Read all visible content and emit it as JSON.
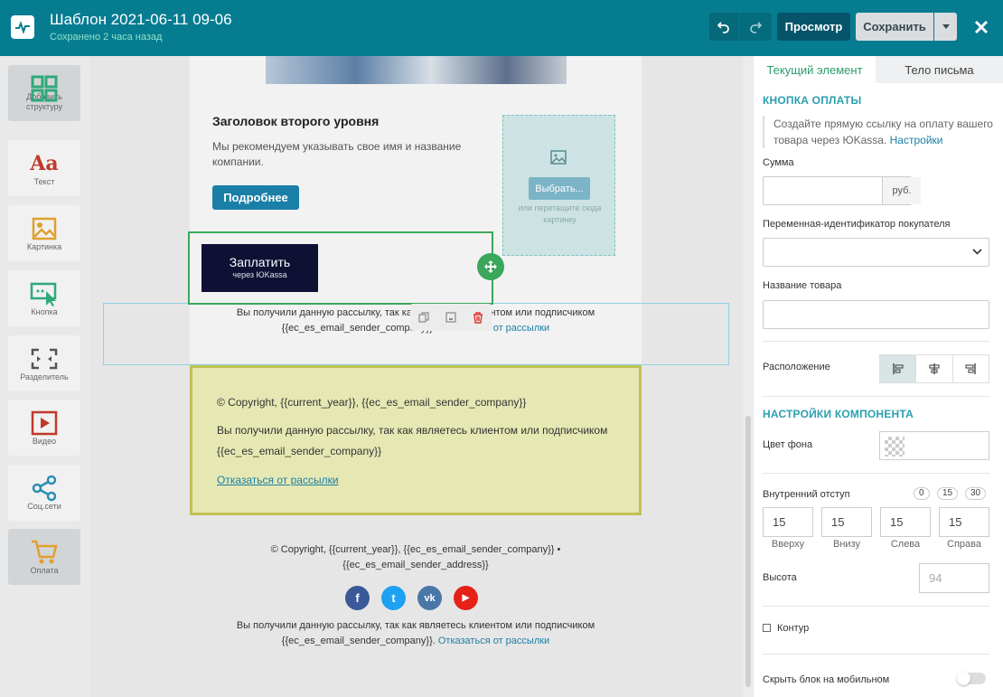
{
  "header": {
    "title": "Шаблон 2021-06-11 09-06",
    "subtitle": "Сохранено 2 часа назад",
    "preview_label": "Просмотр",
    "save_label": "Сохранить"
  },
  "palette": [
    {
      "label": "Добавить структуру",
      "icon": "grid-icon",
      "color": "#2fa87a"
    },
    {
      "label": "Текст",
      "icon": "text-aa-icon",
      "color": "#c0392b"
    },
    {
      "label": "Картинка",
      "icon": "image-icon",
      "color": "#e0a030"
    },
    {
      "label": "Кнопка",
      "icon": "button-cursor-icon",
      "color": "#2fa87a"
    },
    {
      "label": "Разделитель",
      "icon": "divider-icon",
      "color": "#555"
    },
    {
      "label": "Видео",
      "icon": "video-play-icon",
      "color": "#c0392b"
    },
    {
      "label": "Соц.сети",
      "icon": "share-icon",
      "color": "#2b8fb5"
    },
    {
      "label": "Оплата",
      "icon": "cart-icon",
      "color": "#e0a030"
    }
  ],
  "canvas": {
    "heading": "Заголовок второго уровня",
    "paragraph": "Мы рекомендуем указывать свое имя и название компании.",
    "more_button": "Подробнее",
    "choose_button": "Выбрать...",
    "drop_hint": "или перетащите сюда картинку",
    "pay_button_main": "Заплатить",
    "pay_button_sub": "через ЮKassa",
    "footer_text": "Вы получили данную рассылку, так как являетесь клиентом или подписчиком",
    "footer_company": "{{ec_es_email_sender_company}}.",
    "unsubscribe": "Отказаться от рассылки",
    "copyright": "© Copyright, {{current_year}}, {{ec_es_email_sender_company}}",
    "yellow_text": "Вы получили данную рассылку, так как являетесь клиентом или подписчиком",
    "yellow_company": "{{ec_es_email_sender_company}}",
    "copyright2": "© Copyright, {{current_year}}, {{ec_es_email_sender_company}} •",
    "address": "{{ec_es_email_sender_address}}",
    "socials": [
      {
        "name": "facebook-icon",
        "glyph": "f",
        "color": "#3b5998"
      },
      {
        "name": "twitter-icon",
        "glyph": "t",
        "color": "#1da1f2"
      },
      {
        "name": "vk-icon",
        "glyph": "vk",
        "color": "#4a76a8"
      },
      {
        "name": "youtube-icon",
        "glyph": "▶",
        "color": "#e62117"
      }
    ]
  },
  "panel": {
    "tab_current": "Текущий элемент",
    "tab_body": "Тело письма",
    "section_payment": "КНОПКА ОПЛАТЫ",
    "desc": "Создайте прямую ссылку на оплату вашего товара через ЮKassa.",
    "settings_link": "Настройки",
    "sum_label": "Сумма",
    "currency": "руб.",
    "buyer_var_label": "Переменная-идентификатор покупателя",
    "product_label": "Название товара",
    "position_label": "Расположение",
    "section_component": "НАСТРОЙКИ КОМПОНЕНТА",
    "bg_color_label": "Цвет фона",
    "padding_label": "Внутренний отступ",
    "padding_presets": [
      "0",
      "15",
      "30"
    ],
    "padding": [
      {
        "value": "15",
        "label": "Вверху"
      },
      {
        "value": "15",
        "label": "Внизу"
      },
      {
        "value": "15",
        "label": "Слева"
      },
      {
        "value": "15",
        "label": "Справа"
      }
    ],
    "height_label": "Высота",
    "height_placeholder": "94",
    "outline_label": "Контур",
    "hide_mobile_label": "Скрыть блок на мобильном"
  }
}
